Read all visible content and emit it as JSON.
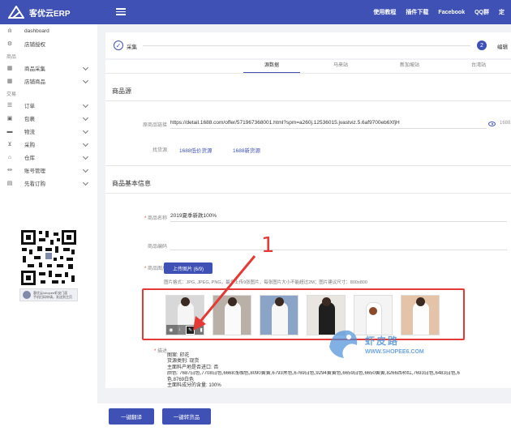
{
  "app": {
    "name": "客优云ERP",
    "top_links": [
      "使用教程",
      "插件下载",
      "Facebook",
      "QQ群",
      "定"
    ]
  },
  "sidebar": {
    "items": [
      {
        "label": "dashboard",
        "icon": "bar-chart-icon",
        "expandable": false
      },
      {
        "label": "店铺授权",
        "icon": "gear-icon",
        "expandable": false
      }
    ],
    "section_goods": "商品",
    "goods_items": [
      {
        "label": "商品采集",
        "icon": "grid-icon",
        "expandable": true
      },
      {
        "label": "店铺商品",
        "icon": "grid-icon",
        "expandable": true
      }
    ],
    "section_trade": "交易",
    "trade_items": [
      {
        "label": "订单",
        "icon": "list-icon",
        "expandable": true
      },
      {
        "label": "包裹",
        "icon": "box-icon",
        "expandable": true
      },
      {
        "label": "物流",
        "icon": "truck-icon",
        "expandable": true
      },
      {
        "label": "采购",
        "icon": "cart-icon",
        "expandable": true
      },
      {
        "label": "仓库",
        "icon": "warehouse-icon",
        "expandable": true
      },
      {
        "label": "账号管理",
        "icon": "bank-icon",
        "expandable": true
      },
      {
        "label": "先看订购",
        "icon": "calendar-icon",
        "expandable": true
      }
    ],
    "qr_card_line1": "客优云/shopee虾皮门面",
    "qr_card_line2": "手机扫码申请，发送到主页"
  },
  "stepper": {
    "step1": "采集",
    "step2_num": "2",
    "step2": "编辑"
  },
  "tabs": [
    "源数据",
    "马来站",
    "新加坡站",
    "台湾站"
  ],
  "source_section": {
    "title": "商品源",
    "link_label": "原商品链接",
    "link_value": "https://detail.1688.com/offer/571967368001.html?spm=a260j.12536015.jvastviz.5.6af9700eb6XfjH",
    "link_suffix": "1688",
    "find_label": "找货源",
    "find_link1": "1688低价货源",
    "find_link2": "1688新货源"
  },
  "basic_section": {
    "title": "商品基本信息",
    "name_label": "商品名称",
    "name_value": "2019夏季新款100%",
    "code_label": "商品编码",
    "image_label": "商品图片",
    "upload_label": "上传图片 (6/9)",
    "image_hint": "图片格式：JPG, JPEG, PNG，最多上传9张图片，每张图片大小不能超过2M；图片建议尺寸：800x800",
    "thumb_tools": [
      "eye-icon",
      "download-icon",
      "edit-icon",
      "delete-icon"
    ],
    "desc_label": "描述",
    "desc_lines": [
      "图案: 印花",
      "货源类别: 现货",
      "主面料产地是否进口: 否",
      "颜色: 7687白色,7708白色,6668浅咖色,8090黄黄,6793黑色,6769白色,9294黄黄色,6659白色,6650黄黄,8266西柿红,7693白色,6483白色,6",
      "色,8769白色",
      "主面料成分的含量: 100%"
    ]
  },
  "actions": {
    "translate": "一键翻译",
    "sell": "一键转货品"
  },
  "annotation": {
    "number": "1"
  },
  "watermark": {
    "text": "虾皮路",
    "url": "WWW.SHOPEE6.COM"
  },
  "colors": {
    "primary": "#3f51b5",
    "annotation": "#e53935"
  }
}
